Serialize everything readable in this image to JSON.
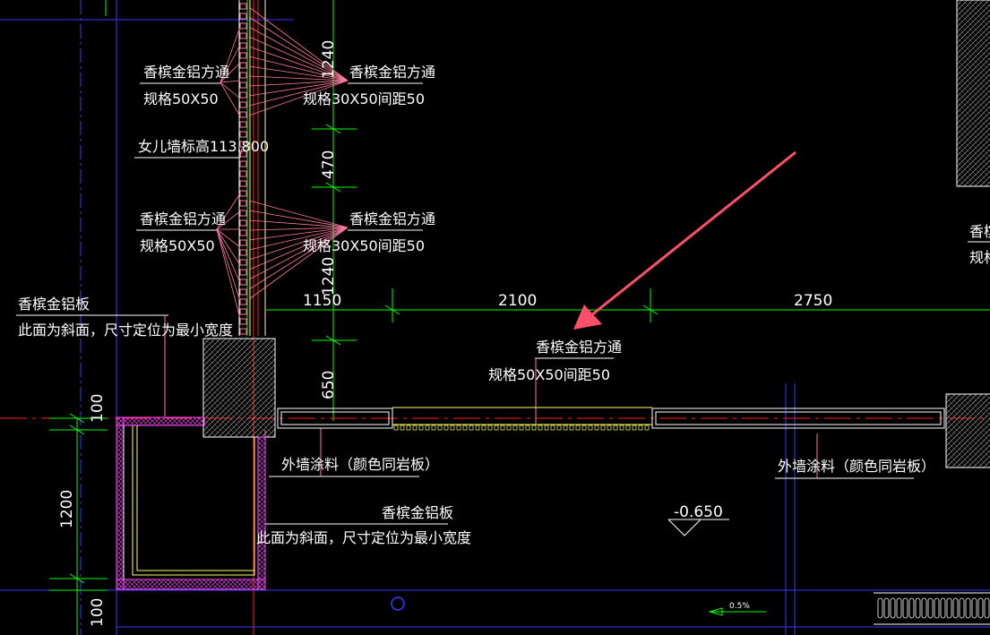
{
  "colors": {
    "background": "#000000",
    "dimension": "#00ff00",
    "grid_blue": "#3a3aff",
    "axis_red": "#ff2020",
    "leader_pink": "#ff7aa0",
    "wall_yellow": "#ffff66",
    "hatch_magenta": "#ff44ff",
    "text": "#ffffff",
    "arrow": "#ff4f6a"
  },
  "labels": {
    "upper_left_name": "香槟金铝方通",
    "upper_left_spec": "规格50X50",
    "upper_right_name": "香槟金铝方通",
    "upper_right_spec": "规格30X50间距50",
    "parapet": "女儿墙标高113.800",
    "mid_left_name": "香槟金铝方通",
    "mid_left_spec": "规格50X50",
    "mid_right_name": "香槟金铝方通",
    "mid_right_spec": "规格30X50间距50",
    "left_panel_name": "香槟金铝板",
    "left_panel_note": "此面为斜面，尺寸定位为最小宽度",
    "center_name": "香槟金铝方通",
    "center_spec": "规格50X50间距50",
    "coating_left": "外墙涂料（颜色同岩板）",
    "coating_right": "外墙涂料（颜色同岩板）",
    "bottom_panel_name": "香槟金铝板",
    "bottom_panel_note": "此面为斜面，尺寸定位为最小宽度",
    "right_edge_name": "香槟",
    "right_edge_spec": "规格",
    "elevation": "-0.650",
    "slope": "0.5%"
  },
  "dimensions": {
    "d1240_top": "1240",
    "d470": "470",
    "d1240_mid": "1240",
    "d1150": "1150",
    "d2100": "2100",
    "d2750": "2750",
    "d650": "650",
    "d100_top": "100",
    "d1200": "1200",
    "d100_bottom": "100"
  }
}
